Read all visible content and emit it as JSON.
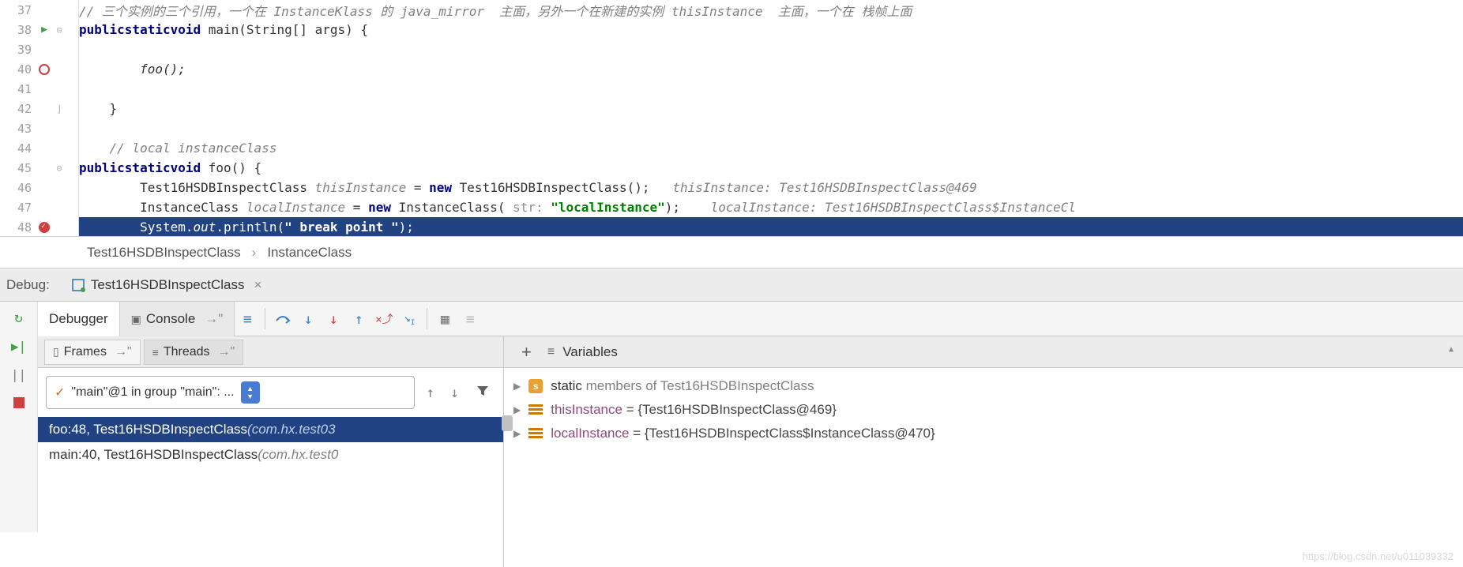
{
  "gutter": {
    "lines": [
      37,
      38,
      39,
      40,
      41,
      42,
      43,
      44,
      45,
      46,
      47,
      48
    ]
  },
  "code": {
    "line37_comment": "// 三个实例的三个引用，一个在 InstanceKlass 的 java_mirror  主面，另外一个在新建的实例 thisInstance  主面，一个在 栈帧上面",
    "line38_kw1": "public",
    "line38_kw2": "static",
    "line38_kw3": "void",
    "line38_rest": " main(String[] args) {",
    "line40": "        foo();",
    "line42": "    }",
    "line44": "    // local instanceClass",
    "line45_kw1": "public",
    "line45_kw2": "static",
    "line45_kw3": "void",
    "line45_rest": " foo() {",
    "line46_a": "        Test16HSDBInspectClass ",
    "line46_hint": "thisInstance",
    "line46_b": " = ",
    "line46_new": "new",
    "line46_c": " Test16HSDBInspectClass();",
    "line46_tail": "   thisInstance: Test16HSDBInspectClass@469",
    "line47_a": "        InstanceClass ",
    "line47_hint": "localInstance",
    "line47_b": " = ",
    "line47_new": "new",
    "line47_c": " InstanceClass( ",
    "line47_param": "str: ",
    "line47_str": "\"localInstance\"",
    "line47_d": ");",
    "line47_tail": "    localInstance: Test16HSDBInspectClass$InstanceCl",
    "line48_a": "        System.",
    "line48_out": "out",
    "line48_b": ".println(",
    "line48_str": "\" break point \"",
    "line48_c": ");"
  },
  "breadcrumb": {
    "item1": "Test16HSDBInspectClass",
    "item2": "InstanceClass",
    "sep": "›"
  },
  "debug_label": "Debug:",
  "debug_config": "Test16HSDBInspectClass",
  "tabs": {
    "debugger": "Debugger",
    "console": "Console"
  },
  "frames_tab": "Frames",
  "threads_tab": "Threads",
  "thread_selected": "\"main\"@1 in group \"main\": ...",
  "frames": [
    {
      "method": "foo:48, Test16HSDBInspectClass",
      "pkg": " (com.hx.test03"
    },
    {
      "method": "main:40, Test16HSDBInspectClass",
      "pkg": " (com.hx.test0"
    }
  ],
  "vars_label": "Variables",
  "variables": [
    {
      "kind": "static",
      "name": "static",
      "rest": " members of Test16HSDBInspectClass"
    },
    {
      "kind": "obj",
      "name": "thisInstance",
      "val": " = {Test16HSDBInspectClass@469}"
    },
    {
      "kind": "obj",
      "name": "localInstance",
      "val": " = {Test16HSDBInspectClass$InstanceClass@470}"
    }
  ],
  "watermark": "https://blog.csdn.net/u011039332"
}
